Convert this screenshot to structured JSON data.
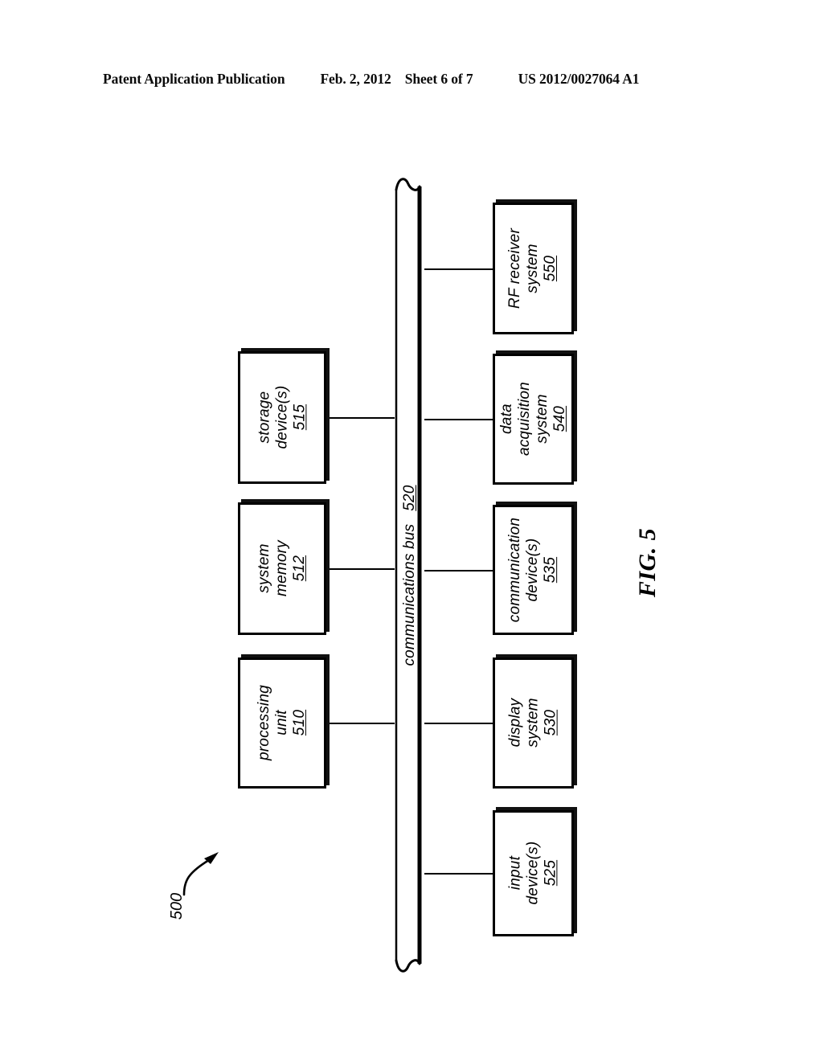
{
  "header": {
    "publication": "Patent Application Publication",
    "date": "Feb. 2, 2012",
    "sheet": "Sheet 6 of 7",
    "doc_number": "US 2012/0027064 A1"
  },
  "figure": {
    "caption": "FIG. 5",
    "system_reference": "500",
    "bus": {
      "name": "communications bus",
      "ref": "520"
    },
    "blocks": [
      {
        "id": "storage-devices",
        "line1": "storage",
        "line2": "device(s)",
        "line3": "",
        "ref": "515",
        "column": "left"
      },
      {
        "id": "system-memory",
        "line1": "system",
        "line2": "memory",
        "line3": "",
        "ref": "512",
        "column": "left"
      },
      {
        "id": "processing-unit",
        "line1": "processing",
        "line2": "unit",
        "line3": "",
        "ref": "510",
        "column": "left"
      },
      {
        "id": "rf-receiver-system",
        "line1": "RF receiver",
        "line2": "system",
        "line3": "",
        "ref": "550",
        "column": "right"
      },
      {
        "id": "data-acquisition",
        "line1": "data",
        "line2": "acquisition",
        "line3": "system",
        "ref": "540",
        "column": "right"
      },
      {
        "id": "communication-devices",
        "line1": "communication",
        "line2": "device(s)",
        "line3": "",
        "ref": "535",
        "column": "right"
      },
      {
        "id": "display-system",
        "line1": "display",
        "line2": "system",
        "line3": "",
        "ref": "530",
        "column": "right"
      },
      {
        "id": "input-devices",
        "line1": "input",
        "line2": "device(s)",
        "line3": "",
        "ref": "525",
        "column": "right"
      }
    ]
  },
  "colors": {
    "ink": "#000000",
    "paper": "#ffffff",
    "shadow": "#111111"
  }
}
